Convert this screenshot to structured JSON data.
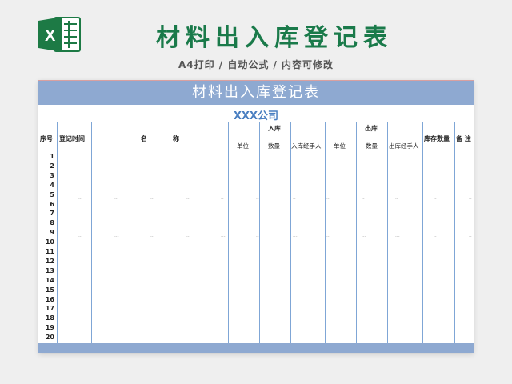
{
  "header": {
    "title": "材料出入库登记表",
    "subtitle": "A4打印 / 自动公式 / 内容可修改"
  },
  "sheet": {
    "banner": "材料出入库登记表",
    "company": "XXX公司",
    "columns": {
      "seq": "序号",
      "date": "登记时间",
      "name_1": "名",
      "name_2": "称",
      "in_group": "入库",
      "out_group": "出库",
      "in_unit": "单位",
      "in_qty": "数量",
      "in_handler": "入库经手人",
      "out_unit": "单位",
      "out_qty": "数量",
      "out_handler": "出库经手人",
      "stock": "库存数量",
      "remark": "备 注"
    },
    "rows": [
      "1",
      "2",
      "3",
      "4",
      "5",
      "6",
      "7",
      "8",
      "9",
      "10",
      "11",
      "12",
      "13",
      "14",
      "15",
      "16",
      "17",
      "18",
      "19",
      "20"
    ]
  },
  "colors": {
    "brand_green": "#1a7a4a",
    "banner_blue": "#8ea9d1",
    "company_blue": "#4a7fc1",
    "grid_blue": "#7fa6d6"
  }
}
